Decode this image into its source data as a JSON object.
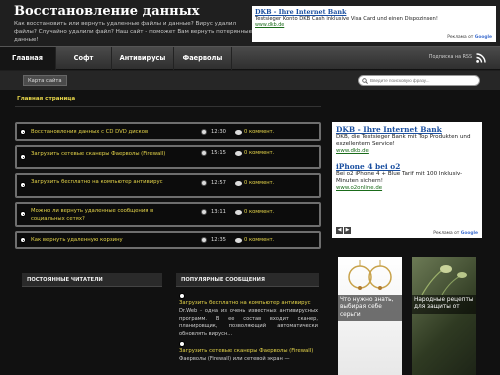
{
  "header": {
    "title": "Восстановление данных",
    "description": "Как восстановить или вернуть удаленные файлы и данные? Вирус удалил файлы? Случайно удалили файл? Наш сайт - поможет Вам вернуть потерянные данные!"
  },
  "top_ad": {
    "title": "DKB - Ihre Internet Bank",
    "text": "Testsieger Konto DKB Cash inklusive Visa Card und einen Dispozinsen!",
    "url": "www.dkb.de",
    "footer_prefix": "Реклама от",
    "footer_brand": "Google"
  },
  "nav": {
    "items": [
      {
        "label": "Главная"
      },
      {
        "label": "Софт"
      },
      {
        "label": "Антивирусы"
      },
      {
        "label": "Фаерволы"
      }
    ],
    "rss_text": "Подписка на RSS",
    "rss_icon": "rss-icon"
  },
  "subbar": {
    "sitemap_label": "Карта сайта",
    "search_placeholder": "Введите поисковую фразу..."
  },
  "main": {
    "breadcrumb": "Главная страница",
    "posts": [
      {
        "title": "Восстановления данных с CD DVD дисков",
        "time": "12:30",
        "comments": "0 коммент."
      },
      {
        "title": "Загрузить сетевые сканеры Фаерволы (Firewall)",
        "time": "15:15",
        "comments": "0 коммент."
      },
      {
        "title": "Загрузить бесплатно на компьютер антивирус",
        "time": "12:57",
        "comments": "0 коммент."
      },
      {
        "title": "Можно ли вернуть удаленные сообщения в социальных сетях?",
        "time": "13:11",
        "comments": "0 коммент."
      },
      {
        "title": "Как вернуть удаленную корзину",
        "time": "12:35",
        "comments": "0 коммент."
      }
    ]
  },
  "side_ad": {
    "ad1_title": "DKB - Ihre Internet Bank",
    "ad1_text": "DKB, die Testsieger Bank mit Top Produkten und exzellentem Service!",
    "ad1_url": "www.dkb.de",
    "ad2_title": "iPhone 4 bei o2",
    "ad2_text": "Bei o2 iPhone 4 + Blue Tarif mit 100 Inklusiv-Minuten sichern!",
    "ad2_url": "www.o2online.de",
    "footer_prefix": "Реклама от",
    "footer_brand": "Google",
    "prev": "◀",
    "next": "▶"
  },
  "widgets": {
    "readers_title": "ПОСТОЯННЫЕ ЧИТАТЕЛИ",
    "popular_title": "ПОПУЛЯРНЫЕ СООБЩЕНИЯ",
    "popular": [
      {
        "link": "Загрузить бесплатно на компьютер антивирус",
        "text": "Dr.Web - одна из очень известных антивирусных программ. В ее состав входит сканер, планировщик, позволяющий автоматически обновлять вирусн..."
      },
      {
        "link": "Загрузить сетевые сканеры Фаерволы (Firewall)",
        "text": "Фаерволы (Firewall) или сетевой экран —"
      }
    ],
    "thumbs": [
      {
        "caption": "Что нужно знать, выбирая себе серьги"
      },
      {
        "caption": "Народные рецепты для защиты от"
      }
    ]
  },
  "colors": {
    "accent": "#e7d64a",
    "background": "#111111",
    "nav": "#3c3c3c"
  }
}
